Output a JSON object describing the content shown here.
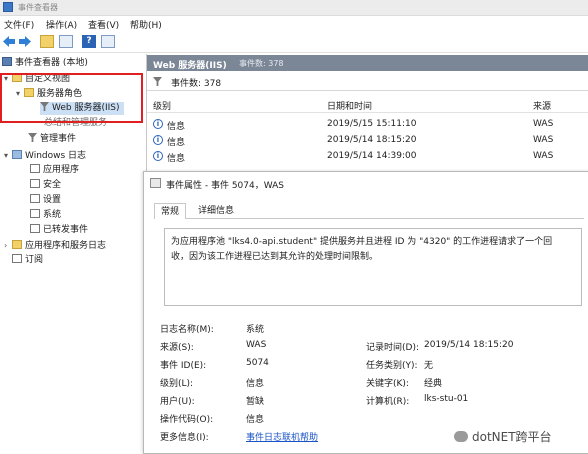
{
  "window": {
    "title": "事件查看器"
  },
  "menu": {
    "file": "文件(F)",
    "action": "操作(A)",
    "view": "查看(V)",
    "help": "帮助(H)"
  },
  "tree": {
    "root": "事件查看器 (本地)",
    "custom_views": "自定义视图",
    "server_roles": "服务器角色",
    "web_server": "Web 服务器(IIS)",
    "admin_events_partial": "总结和管理服务",
    "admin_events": "管理事件",
    "windows_logs": "Windows 日志",
    "application": "应用程序",
    "security": "安全",
    "setup": "设置",
    "system": "系统",
    "forwarded": "已转发事件",
    "app_service_logs": "应用程序和服务日志",
    "subscriptions": "订阅"
  },
  "panel": {
    "header_title": "Web 服务器(IIS)",
    "header_count": "事件数: 378",
    "count_label": "事件数: 378",
    "columns": {
      "level": "级别",
      "datetime": "日期和时间",
      "source": "来源"
    },
    "rows": [
      {
        "level": "信息",
        "datetime": "2019/5/15 15:11:10",
        "source": "WAS"
      },
      {
        "level": "信息",
        "datetime": "2019/5/14 18:15:20",
        "source": "WAS"
      },
      {
        "level": "信息",
        "datetime": "2019/5/14 14:39:00",
        "source": "WAS"
      }
    ]
  },
  "dialog": {
    "title": "事件属性 - 事件 5074，WAS",
    "tab_general": "常规",
    "tab_details": "详细信息",
    "description_line1": "为应用程序池 \"lks4.0-api.student\" 提供服务并且进程 ID 为 \"4320\" 的工作进程请求了一个回",
    "description_line2": "收，因为该工作进程已达到其允许的处理时间限制。",
    "log_name_label": "日志名称(M):",
    "log_name_value": "系统",
    "source_label": "来源(S):",
    "source_value": "WAS",
    "logged_label": "记录时间(D):",
    "logged_value": "2019/5/14 18:15:20",
    "event_id_label": "事件 ID(E):",
    "event_id_value": "5074",
    "task_label": "任务类别(Y):",
    "task_value": "无",
    "level_label": "级别(L):",
    "level_value": "信息",
    "keywords_label": "关键字(K):",
    "keywords_value": "经典",
    "user_label": "用户(U):",
    "user_value": "暂缺",
    "computer_label": "计算机(R):",
    "computer_value": "lks-stu-01",
    "opcode_label": "操作代码(O):",
    "opcode_value": "信息",
    "more_info_label": "更多信息(I):",
    "more_info_link": "事件日志联机帮助"
  },
  "watermark": "dotNET跨平台",
  "colors": {
    "header_bg": "#7b8796",
    "highlight_box": "#e02020",
    "link": "#1a53c8"
  }
}
